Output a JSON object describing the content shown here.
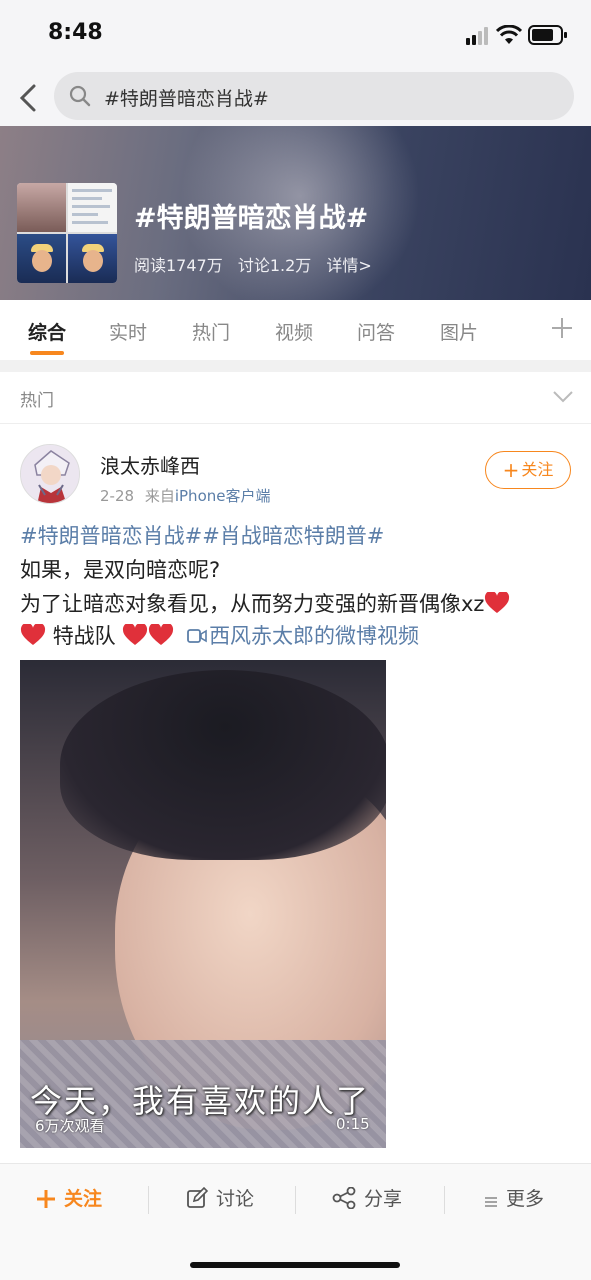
{
  "status_bar": {
    "time": "8:48"
  },
  "search": {
    "query": "#特朗普暗恋肖战#"
  },
  "topic": {
    "title": "#特朗普暗恋肖战#",
    "reads": "阅读1747万",
    "discussions": "讨论1.2万",
    "details": "详情>"
  },
  "tabs": [
    {
      "label": "综合",
      "active": true
    },
    {
      "label": "实时"
    },
    {
      "label": "热门"
    },
    {
      "label": "视频"
    },
    {
      "label": "问答"
    },
    {
      "label": "图片"
    }
  ],
  "section": {
    "label": "热门"
  },
  "post": {
    "username": "浪太赤峰西",
    "date": "2-28",
    "source_prefix": "来自",
    "source": "iPhone客户端",
    "follow_label": "关注",
    "hashtags": "#特朗普暗恋肖战##肖战暗恋特朗普#",
    "line2": "如果，是双向暗恋呢?",
    "line3": "为了让暗恋对象看见，从而努力变强的新晋偶像xz",
    "line4_text": "特战队",
    "video_link": "西风赤太郎的微博视频",
    "video": {
      "subtitle": "今天，我有喜欢的人了",
      "views": "6万次观看",
      "duration": "0:15"
    }
  },
  "toolbar": {
    "follow": "关注",
    "comment": "讨论",
    "share": "分享",
    "more": "更多"
  },
  "colors": {
    "accent": "#f7871e",
    "link": "#5b7ea8"
  }
}
